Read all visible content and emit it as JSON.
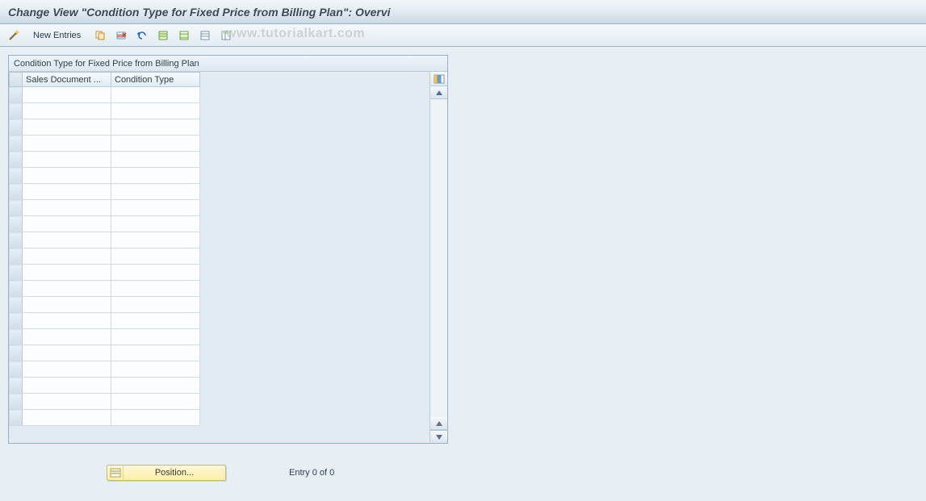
{
  "title": "Change View \"Condition Type for Fixed Price from Billing Plan\": Overvi",
  "toolbar": {
    "new_entries_label": "New Entries"
  },
  "panel": {
    "header": "Condition Type for Fixed Price from Billing Plan",
    "columns": [
      "Sales Document ...",
      "Condition Type"
    ],
    "row_count": 21
  },
  "footer": {
    "position_label": "Position...",
    "entry_text": "Entry 0 of 0"
  },
  "watermark": "www.tutorialkart.com",
  "icons": {
    "wand": "wand-icon",
    "copy": "copy-icon",
    "delete_row": "delete-row-icon",
    "undo": "undo-icon",
    "select_all": "select-all-icon",
    "select_block": "select-block-icon",
    "deselect": "deselect-icon",
    "configure": "configure-columns-icon",
    "up": "scroll-up-icon",
    "down": "scroll-down-icon",
    "position": "position-icon"
  }
}
